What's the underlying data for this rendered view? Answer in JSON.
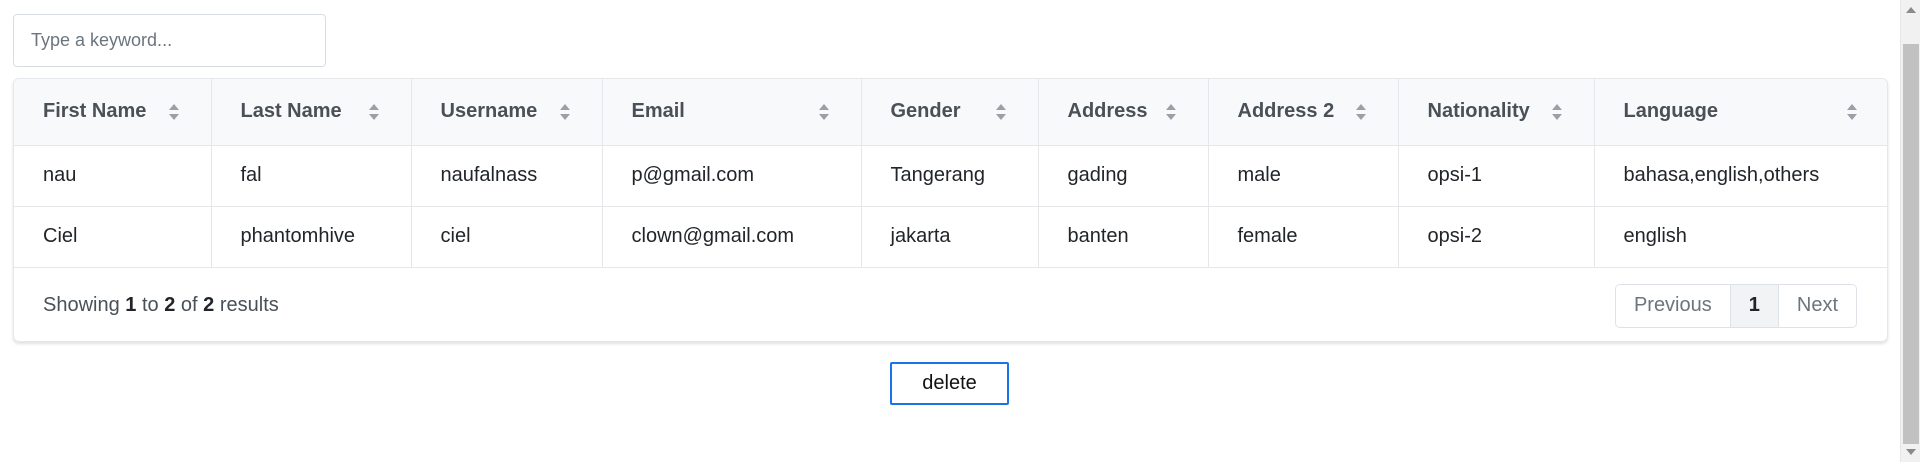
{
  "search": {
    "placeholder": "Type a keyword..."
  },
  "table": {
    "columns": [
      "First Name",
      "Last Name",
      "Username",
      "Email",
      "Gender",
      "Address",
      "Address 2",
      "Nationality",
      "Language"
    ],
    "rows": [
      [
        "nau",
        "fal",
        "naufalnass",
        "p@gmail.com",
        "Tangerang",
        "gading",
        "male",
        "opsi-1",
        "bahasa,english,others"
      ],
      [
        "Ciel",
        "phantomhive",
        "ciel",
        "clown@gmail.com",
        "jakarta",
        "banten",
        "female",
        "opsi-2",
        "english"
      ]
    ]
  },
  "footer": {
    "showing": "Showing",
    "from": "1",
    "to_word": "to",
    "to": "2",
    "of_word": "of",
    "total": "2",
    "results": "results"
  },
  "pagination": {
    "previous": "Previous",
    "current": "1",
    "next": "Next"
  },
  "actions": {
    "delete_label": "delete"
  },
  "icons": {
    "sort": "sort-icon"
  },
  "colors": {
    "accent": "#1a73e8",
    "header_bg": "#f8f9fa",
    "sort_icon": "#9aa0a6"
  }
}
